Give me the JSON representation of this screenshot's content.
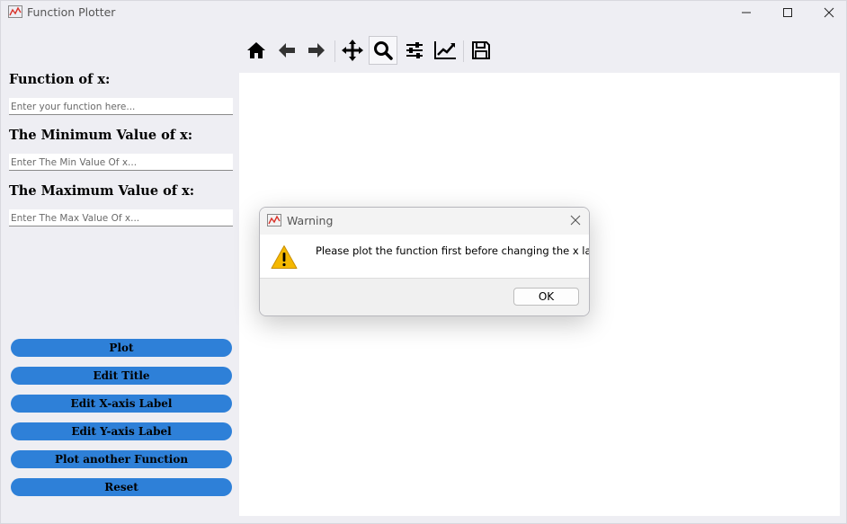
{
  "window": {
    "title": "Function Plotter"
  },
  "toolbar": {
    "tools": [
      "home-icon",
      "back-arrow-icon",
      "forward-arrow-icon",
      "pan-icon",
      "zoom-icon",
      "configure-subplots-icon",
      "edit-axis-icon",
      "save-icon"
    ],
    "active_tool": "zoom-icon"
  },
  "form": {
    "function_label": "Function of x:",
    "function_placeholder": "Enter your function here...",
    "min_label": "The Minimum Value of x:",
    "min_placeholder": "Enter The Min Value Of x...",
    "max_label": "The Maximum Value of x:",
    "max_placeholder": "Enter The Max Value Of x..."
  },
  "buttons": {
    "plot": "Plot",
    "edit_title": "Edit Title",
    "edit_x_label": "Edit X-axis Label",
    "edit_y_label": "Edit Y-axis Label",
    "plot_another": "Plot another Function",
    "reset": "Reset"
  },
  "dialog": {
    "title": "Warning",
    "message": "Please plot the function first before changing the x label",
    "ok_label": "OK"
  },
  "colors": {
    "button_blue": "#2e80d8",
    "warning_yellow": "#f5b800"
  }
}
